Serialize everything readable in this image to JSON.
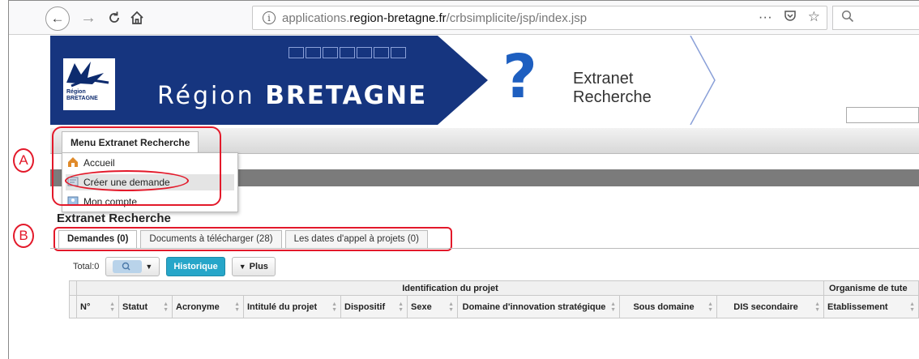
{
  "browser": {
    "back": "←",
    "forward": "→",
    "reload": "C",
    "home": "⌂",
    "url_host": "applications.",
    "url_domain": "region-bretagne.fr",
    "url_path": "/crbsimplicite/jsp/index.jsp",
    "more": "···",
    "pocket": "♡",
    "bookmark": "☆",
    "search_icon": "magnifier-icon"
  },
  "banner": {
    "logo_text_1": "Région",
    "logo_text_2": "BRETAGNE",
    "region_prefix": "Région ",
    "region_name": "BRETAGNE",
    "app_title_1": "Extranet",
    "app_title_2": "Recherche"
  },
  "menu": {
    "tab_label": "Menu Extranet Recherche",
    "items": [
      {
        "label": "Accueil",
        "icon": "home-icon"
      },
      {
        "label": "Créer une demande",
        "icon": "form-icon"
      },
      {
        "label": "Mon compte",
        "icon": "account-icon"
      }
    ]
  },
  "annotations": {
    "a": "A",
    "b": "B"
  },
  "content": {
    "heading": "Extranet Recherche",
    "tabs": [
      {
        "label": "Demandes (0)"
      },
      {
        "label": "Documents à télécharger (28)"
      },
      {
        "label": "Les dates d'appel à projets (0)"
      }
    ],
    "toolbar": {
      "total": "Total:0",
      "historique": "Historique",
      "plus": "Plus"
    },
    "grid": {
      "group_1": "Identification du projet",
      "group_2": "Organisme de tute",
      "columns": [
        "N°",
        "Statut",
        "Acronyme",
        "Intitulé du projet",
        "Dispositif",
        "Sexe",
        "Domaine d'innovation stratégique",
        "Sous domaine",
        "DIS secondaire",
        "Etablissement"
      ]
    }
  },
  "colors": {
    "banner_blue": "#16357f",
    "accent_red": "#e3192a",
    "historique_teal": "#26a6c9"
  }
}
